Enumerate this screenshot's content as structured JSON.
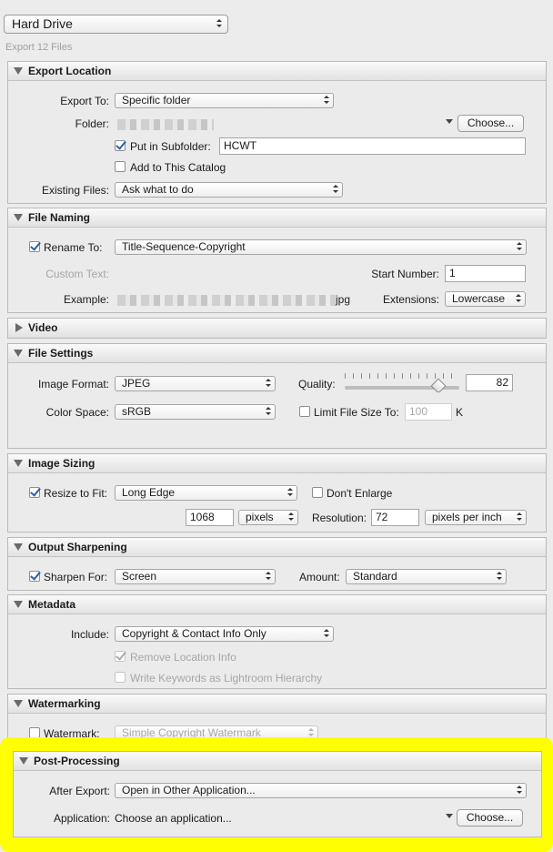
{
  "preset": {
    "label": "Hard Drive"
  },
  "export_count": "Export 12 Files",
  "export_location": {
    "title": "Export Location",
    "export_to_label": "Export To:",
    "export_to_value": "Specific folder",
    "folder_label": "Folder:",
    "choose_label": "Choose...",
    "put_in_subfolder_label": "Put in Subfolder:",
    "put_in_subfolder_checked": true,
    "subfolder_value": "HCWT",
    "add_to_catalog_label": "Add to This Catalog",
    "add_to_catalog_checked": false,
    "existing_files_label": "Existing Files:",
    "existing_files_value": "Ask what to do"
  },
  "file_naming": {
    "title": "File Naming",
    "rename_to_label": "Rename To:",
    "rename_to_checked": true,
    "rename_to_value": "Title-Sequence-Copyright",
    "custom_text_label": "Custom Text:",
    "start_number_label": "Start Number:",
    "start_number_value": "1",
    "example_label": "Example:",
    "example_suffix": "jpg",
    "extensions_label": "Extensions:",
    "extensions_value": "Lowercase"
  },
  "video": {
    "title": "Video"
  },
  "file_settings": {
    "title": "File Settings",
    "image_format_label": "Image Format:",
    "image_format_value": "JPEG",
    "quality_label": "Quality:",
    "quality_value": "82",
    "quality_fraction": 0.82,
    "color_space_label": "Color Space:",
    "color_space_value": "sRGB",
    "limit_size_label": "Limit File Size To:",
    "limit_size_checked": false,
    "limit_size_value": "100",
    "limit_size_unit": "K"
  },
  "image_sizing": {
    "title": "Image Sizing",
    "resize_label": "Resize to Fit:",
    "resize_checked": true,
    "resize_value": "Long Edge",
    "dont_enlarge_label": "Don't Enlarge",
    "dont_enlarge_checked": false,
    "size_value": "1068",
    "size_unit": "pixels",
    "resolution_label": "Resolution:",
    "resolution_value": "72",
    "resolution_unit": "pixels per inch"
  },
  "output_sharpening": {
    "title": "Output Sharpening",
    "sharpen_label": "Sharpen For:",
    "sharpen_checked": true,
    "sharpen_value": "Screen",
    "amount_label": "Amount:",
    "amount_value": "Standard"
  },
  "metadata": {
    "title": "Metadata",
    "include_label": "Include:",
    "include_value": "Copyright & Contact Info Only",
    "remove_location_label": "Remove Location Info",
    "remove_location_checked": true,
    "keywords_label": "Write Keywords as Lightroom Hierarchy",
    "keywords_checked": false
  },
  "watermarking": {
    "title": "Watermarking",
    "watermark_label": "Watermark:",
    "watermark_checked": false,
    "watermark_value": "Simple Copyright Watermark"
  },
  "post_processing": {
    "title": "Post-Processing",
    "after_export_label": "After Export:",
    "after_export_value": "Open in Other Application...",
    "application_label": "Application:",
    "application_value": "Choose an application...",
    "choose_label": "Choose...",
    "highlight_color": "#ffff00"
  }
}
